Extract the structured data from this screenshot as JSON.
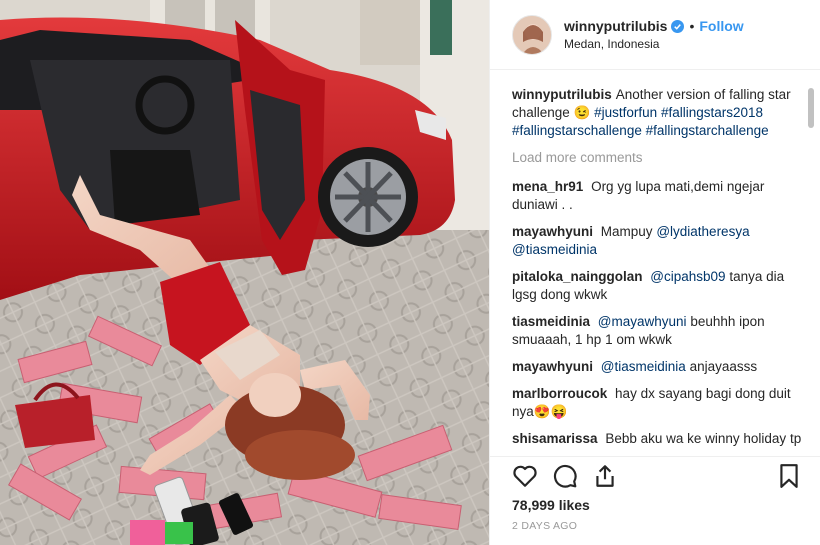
{
  "header": {
    "username": "winnyputrilubis",
    "separator": "•",
    "follow_label": "Follow",
    "location": "Medan, Indonesia",
    "avatar_icon": "profile-photo",
    "verified_icon": "verified-badge-icon"
  },
  "caption": {
    "username": "winnyputrilubis",
    "text": "Another version of falling star challenge 😉",
    "hashtags": [
      "#justforfun",
      "#fallingstars2018",
      "#fallingstarschallenge",
      "#fallingstarchallenge"
    ]
  },
  "load_more": "Load more comments",
  "comments": [
    {
      "user": "mena_hr91",
      "mention": "",
      "text": "Org yg lupa mati,demi ngejar duniawi . ."
    },
    {
      "user": "mayawhyuni",
      "mention": "",
      "text": "Mampuy"
    },
    {
      "user": "pitaloka_nainggolan",
      "mention": "@cipahsb09",
      "text": "tanya dia lgsg dong wkwk"
    },
    {
      "user": "tiasmeidinia",
      "mention": "@mayawhyuni",
      "text": "beuhhh ipon smuaaah, 1 hp 1 om wkwk"
    },
    {
      "user": "mayawhyuni",
      "mention": "@tiasmeidinia",
      "text": "anjayaasss"
    },
    {
      "user": "marlborroucok",
      "mention": "",
      "text": "hay dx sayang bagi dong duit nya😍😝"
    },
    {
      "user": "shisamarissa",
      "mention": "",
      "text": "Bebb aku wa ke winny holiday tp blm di respon, bisa di respons beb?"
    }
  ],
  "comment2_mentions": [
    "@lydiatheresya",
    "@tiasmeidinia"
  ],
  "actions": {
    "icons": [
      "heart-icon",
      "comment-icon",
      "share-icon",
      "bookmark-icon"
    ],
    "likes": "78,999 likes",
    "timestamp": "2 DAYS AGO"
  },
  "colors": {
    "link": "#003569",
    "follow": "#3897f0",
    "muted": "#999999",
    "car_red": "#c9161d"
  }
}
